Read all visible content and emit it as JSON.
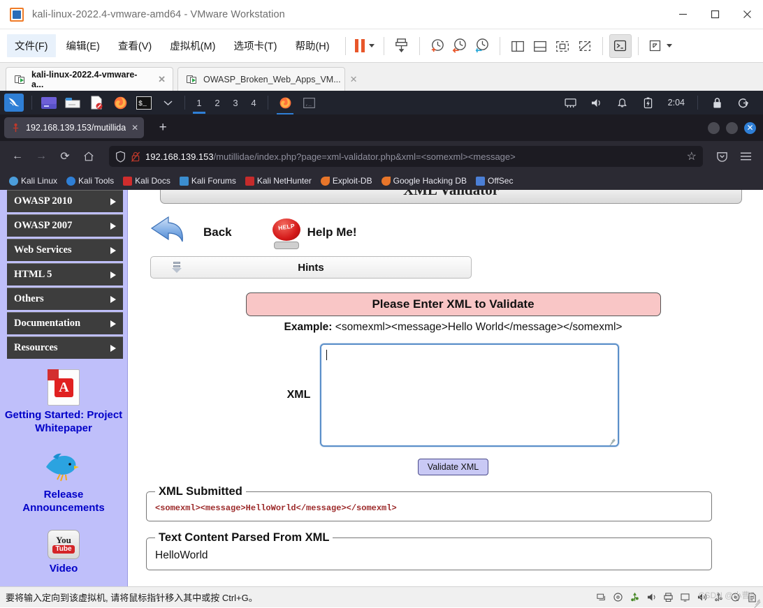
{
  "vmware": {
    "title": "kali-linux-2022.4-vmware-amd64 - VMware Workstation",
    "menu": [
      "文件(F)",
      "编辑(E)",
      "查看(V)",
      "虚拟机(M)",
      "选项卡(T)",
      "帮助(H)"
    ],
    "window_buttons": {
      "minimize": "─",
      "maximize": "□",
      "close": "✕"
    },
    "toolbar": {
      "pause": "pause-icon",
      "pause_dropdown": "caret-down-icon",
      "snapshot": "take-snapshot-icon",
      "snapshot_manager": "snapshot-add-icon",
      "revert": "revert-snapshot-icon",
      "manage_snapshots": "manage-snapshots-icon",
      "show_library": "show-library-icon",
      "show_thumbnails": "show-thumbnail-bar-icon",
      "full_screen": "full-screen-icon",
      "unity": "unity-mode-icon",
      "console": "console-view-icon",
      "stretch": "stretch-guest-icon",
      "stretch_dropdown": "caret-down-icon"
    },
    "tabs": [
      {
        "label": "kali-linux-2022.4-vmware-a...",
        "active": true,
        "close": "✕"
      },
      {
        "label": "OWASP_Broken_Web_Apps_VM...",
        "active": false,
        "close": "✕"
      }
    ],
    "statusbar": {
      "message": "要将输入定向到该虚拟机, 请将鼠标指针移入其中或按 Ctrl+G。",
      "icons": [
        "network-icon",
        "cd-icon",
        "usb-icon",
        "sound-icon",
        "printer-icon",
        "display-icon",
        "speaker-icon",
        "settings-icon",
        "hdd-icon",
        "message-log-icon"
      ],
      "watermark": "CSDN @小曹5"
    }
  },
  "kali_taskbar": {
    "logo": "kali-dragon-icon",
    "launchers": [
      "terminal-emulator-icon",
      "file-manager-icon",
      "text-editor-icon",
      "firefox-icon",
      "terminal-icon"
    ],
    "launcher_dropdown": "chevron-down-icon",
    "workspaces": [
      "1",
      "2",
      "3",
      "4"
    ],
    "active_workspace": "1",
    "window_buttons": [
      "firefox-window",
      "terminal-window"
    ],
    "tray": [
      "network-icon",
      "volume-icon",
      "notification-bell-icon",
      "battery-icon"
    ],
    "clock": "2:04",
    "lock": "lock-icon",
    "logout": "logout-icon"
  },
  "firefox": {
    "tab": {
      "favicon": "mutillidae-favicon",
      "title": "192.168.139.153/mutillida",
      "close": "✕"
    },
    "new_tab": "+",
    "window_controls": {
      "minimize": "minimize-dot",
      "maximize": "maximize-dot",
      "close": "✕"
    },
    "nav": {
      "back": "←",
      "forward": "→",
      "reload": "⟳",
      "home": "⌂",
      "shield": "tracking-protection-icon",
      "insecure_lock": "insecure-connection-icon",
      "bookmark_star": "☆",
      "pocket": "pocket-icon",
      "menu": "hamburger-menu-icon"
    },
    "url": {
      "host": "192.168.139.153",
      "path": "/mutillidae/index.php?page=xml-validator.php&xml=<somexml><message>"
    },
    "bookmarks": [
      {
        "label": "Kali Linux",
        "icon": "kali-dragon-icon",
        "color": "#5fb2e8"
      },
      {
        "label": "Kali Tools",
        "icon": "kali-tools-icon",
        "color": "#2f7fd6"
      },
      {
        "label": "Kali Docs",
        "icon": "kali-docs-icon",
        "color": "#d02d2d"
      },
      {
        "label": "Kali Forums",
        "icon": "kali-forums-icon",
        "color": "#3b8ed0"
      },
      {
        "label": "Kali NetHunter",
        "icon": "kali-nethunter-icon",
        "color": "#c52b2b"
      },
      {
        "label": "Exploit-DB",
        "icon": "exploit-db-icon",
        "color": "#e8762a"
      },
      {
        "label": "Google Hacking DB",
        "icon": "google-hacking-db-icon",
        "color": "#e8762a"
      },
      {
        "label": "OffSec",
        "icon": "offsec-icon",
        "color": "#4b7fd6"
      }
    ]
  },
  "mutillidae": {
    "page_title": "XML Validator",
    "sidebar": {
      "menu": [
        {
          "label": "OWASP 2010",
          "arrow": "right-arrow-icon"
        },
        {
          "label": "OWASP 2007",
          "arrow": "right-arrow-icon"
        },
        {
          "label": "Web Services",
          "arrow": "right-arrow-icon"
        },
        {
          "label": "HTML 5",
          "arrow": "right-arrow-icon"
        },
        {
          "label": "Others",
          "arrow": "right-arrow-icon"
        },
        {
          "label": "Documentation",
          "arrow": "right-arrow-icon"
        },
        {
          "label": "Resources",
          "arrow": "right-arrow-icon"
        }
      ],
      "promos": [
        {
          "icon": "pdf-icon",
          "glyph": "A",
          "title": "Getting Started: Project Whitepaper"
        },
        {
          "icon": "twitter-bird-icon",
          "title": "Release Announcements"
        },
        {
          "icon": "youtube-icon",
          "you": "You",
          "tube": "Tube",
          "title": "Video"
        }
      ]
    },
    "actions": {
      "back_icon": "back-arrow-icon",
      "back_label": "Back",
      "help_icon": "help-button-icon",
      "help_text": "HELP",
      "help_label": "Help Me!",
      "hints_label": "Hints",
      "hints_icon": "collapse-arrow-icon"
    },
    "form": {
      "banner": "Please Enter XML to Validate",
      "example_label": "Example:",
      "example_value": "<somexml><message>Hello World</message></somexml>",
      "xml_label": "XML",
      "xml_value": "",
      "submit_label": "Validate XML"
    },
    "results": {
      "submitted_legend": "XML Submitted",
      "submitted_value": "<somexml><message>HelloWorld</message></somexml>",
      "parsed_legend": "Text Content Parsed From XML",
      "parsed_value": "HelloWorld"
    }
  }
}
